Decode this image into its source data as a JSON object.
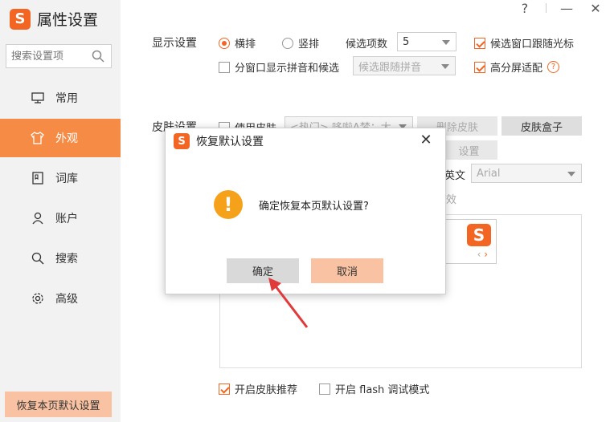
{
  "app": {
    "title": "属性设置",
    "logo_letter": "S"
  },
  "search": {
    "placeholder": "搜索设置项"
  },
  "nav": [
    {
      "label": "常用",
      "icon": "monitor-icon"
    },
    {
      "label": "外观",
      "icon": "tshirt-icon",
      "active": true
    },
    {
      "label": "词库",
      "icon": "book-icon"
    },
    {
      "label": "账户",
      "icon": "user-icon"
    },
    {
      "label": "搜索",
      "icon": "search-icon"
    },
    {
      "label": "高级",
      "icon": "gear-icon"
    }
  ],
  "restore_button": "恢复本页默认设置",
  "window": {
    "help": "?",
    "minimize": "—",
    "close": "✕"
  },
  "display": {
    "label": "显示设置",
    "horizontal": "横排",
    "vertical": "竖排",
    "candidate_count_label": "候选项数",
    "candidate_count": "5",
    "follow_cursor": "候选窗口跟随光标",
    "split_window": "分窗口显示拼音和候选",
    "split_mode": "候选跟随拼音",
    "hidpi": "高分屏适配"
  },
  "skin": {
    "label": "皮肤设置",
    "use_skin": "使用皮肤",
    "skin_select": "<热门> 哆啦A梦：大",
    "delete_skin": "删除皮肤",
    "skin_box": "皮肤盒子",
    "settings": "设置",
    "english_label": "英文",
    "font": "Arial",
    "partial": "效",
    "enable_recommend": "开启皮肤推荐",
    "flash_debug": "开启 flash 调试模式"
  },
  "modal": {
    "title": "恢复默认设置",
    "message": "确定恢复本页默认设置?",
    "ok": "确定",
    "cancel": "取消",
    "close": "✕",
    "warn_symbol": "!"
  },
  "colors": {
    "accent": "#f26522",
    "nav_active": "#f58b45",
    "restore_bg": "#f9c3a3",
    "warning": "#f5a21a"
  }
}
